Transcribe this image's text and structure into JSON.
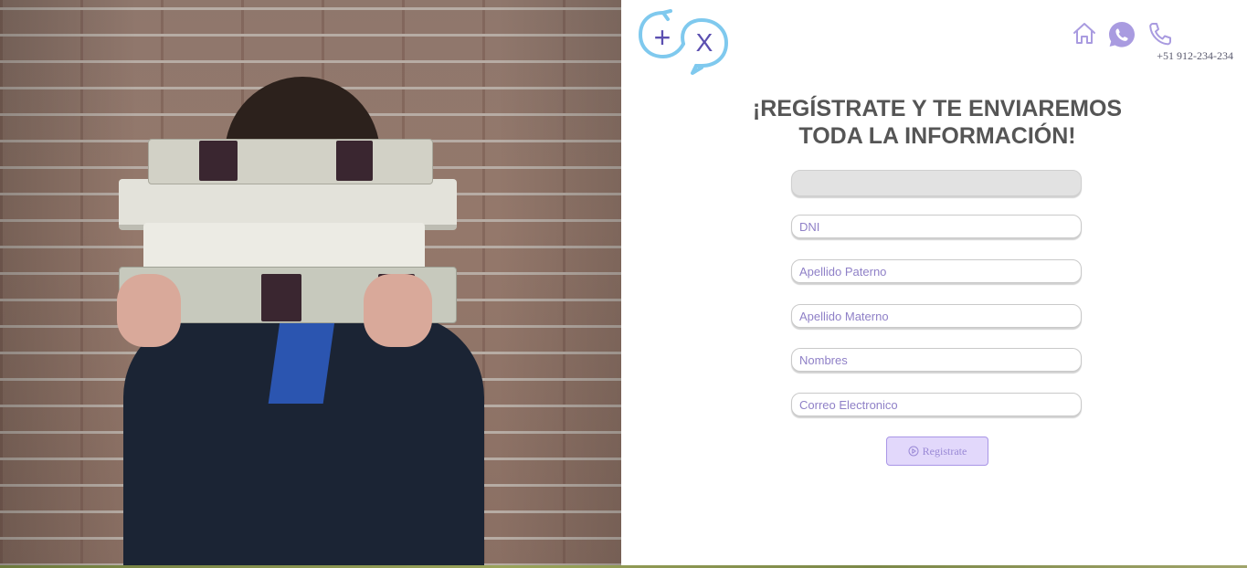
{
  "brand": {
    "logo_plus": "+",
    "logo_x": "X",
    "colors": {
      "blue": "#7fc9ee",
      "purple": "#5b4fb0",
      "icon_lavender": "#a99be0"
    }
  },
  "header": {
    "icons": [
      "home-icon",
      "whatsapp-icon",
      "phone-icon"
    ],
    "phone_number": "+51 912-234-234"
  },
  "form": {
    "headline_line1": "¡REGÍSTRATE Y TE ENVIAREMOS",
    "headline_line2": "TODA LA INFORMACIÓN!",
    "fields": {
      "first": {
        "placeholder": "",
        "value": ""
      },
      "dni": {
        "placeholder": "DNI"
      },
      "apellido_paterno": {
        "placeholder": "Apellido Paterno"
      },
      "apellido_materno": {
        "placeholder": "Apellido Materno"
      },
      "nombres": {
        "placeholder": "Nombres"
      },
      "correo": {
        "placeholder": "Correo Electronico"
      }
    },
    "submit_label": "Registrate",
    "submit_icon": "play-circle-icon"
  }
}
